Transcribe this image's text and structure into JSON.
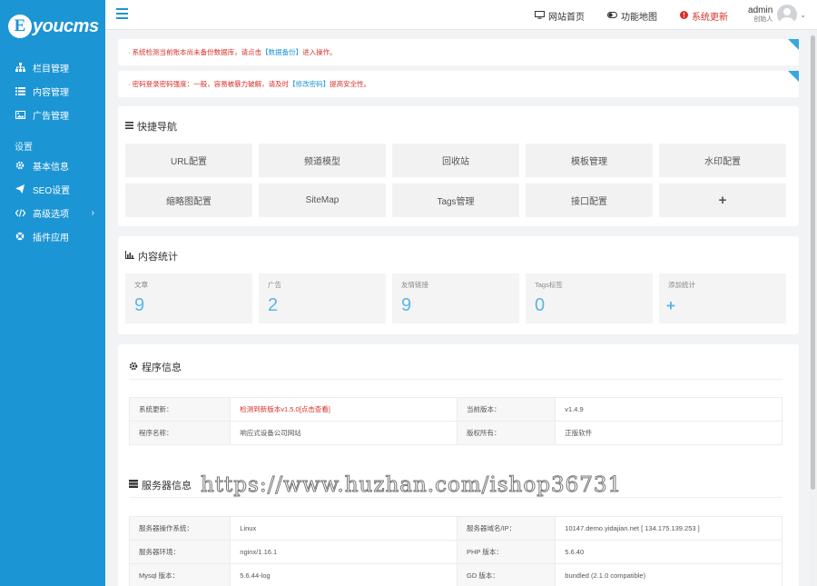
{
  "app": {
    "logo_letter": "E",
    "logo_text": "youcms",
    "brand_color": "#1c95d4"
  },
  "sidebar": {
    "items": [
      {
        "label": "栏目管理",
        "icon": "sitemap-icon"
      },
      {
        "label": "内容管理",
        "icon": "list-icon"
      },
      {
        "label": "广告管理",
        "icon": "image-icon"
      }
    ],
    "settings_heading": "设置",
    "settings_items": [
      {
        "label": "基本信息",
        "icon": "gear-icon"
      },
      {
        "label": "SEO设置",
        "icon": "paper-plane-icon"
      },
      {
        "label": "高级选项",
        "icon": "code-icon",
        "arrow": "›"
      },
      {
        "label": "插件应用",
        "icon": "life-ring-icon"
      }
    ]
  },
  "topbar": {
    "site_home": "网站首页",
    "function_map": "功能地图",
    "system_update": "系统更新",
    "user_name": "admin",
    "user_role": "创始人"
  },
  "alerts": [
    {
      "prefix": "· 系统检测当前账本尚未备份数据库，请点击",
      "link": "【数据备份】",
      "suffix": "进入操作。"
    },
    {
      "prefix": "· 密码登录密码强度：一般，容易被暴力破解，请及时",
      "link": "【修改密码】",
      "suffix": "提高安全性。"
    }
  ],
  "quick_nav": {
    "title": "快捷导航",
    "buttons": [
      "URL配置",
      "频道模型",
      "回收站",
      "模板管理",
      "水印配置",
      "缩略图配置",
      "SiteMap",
      "Tags管理",
      "接口配置",
      "+"
    ]
  },
  "stats": {
    "title": "内容统计",
    "cards": [
      {
        "label": "文章",
        "value": "9"
      },
      {
        "label": "广告",
        "value": "2"
      },
      {
        "label": "友情链接",
        "value": "9"
      },
      {
        "label": "Tags标签",
        "value": "0"
      }
    ],
    "add_label": "添加统计",
    "add_symbol": "+"
  },
  "program_info": {
    "title": "程序信息",
    "rows": [
      {
        "k1": "系统更新：",
        "v1": "检测到新版本v1.5.0[点击查看]",
        "k2": "当前版本：",
        "v2": "v1.4.9"
      },
      {
        "k1": "程序名称：",
        "v1": "响应式设备公司网站",
        "k2": "版权所有：",
        "v2": "正版软件"
      }
    ]
  },
  "server_info": {
    "title": "服务器信息",
    "rows": [
      {
        "k1": "服务器操作系统：",
        "v1": "Linux",
        "k2": "服务器域名/IP：",
        "v2": "10147.demo.yidajian.net [ 134.175.139.253 ]"
      },
      {
        "k1": "服务器环境：",
        "v1": "nginx/1.16.1",
        "k2": "PHP 版本：",
        "v2": "5.6.40"
      },
      {
        "k1": "Mysql 版本：",
        "v1": "5.6.44-log",
        "k2": "GD 版本：",
        "v2": "bundled (2.1.0 compatible)"
      }
    ]
  },
  "watermark": "https://www.huzhan.com/ishop36731"
}
